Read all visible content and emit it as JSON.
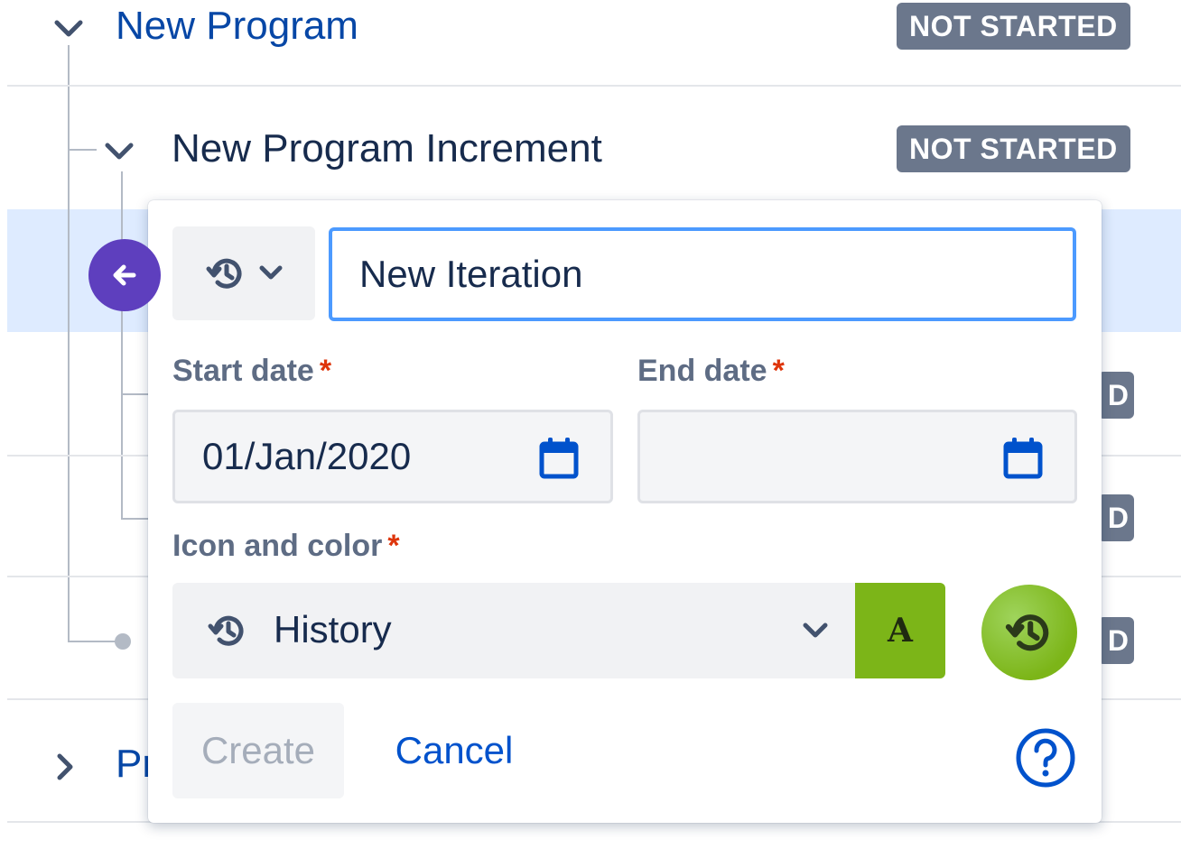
{
  "tree": {
    "rows": [
      {
        "title": "New Program",
        "status": "NOT STARTED"
      },
      {
        "title": "New Program Increment",
        "status": "NOT STARTED"
      },
      {
        "partial_badge": "D"
      },
      {
        "partial_badge": "D"
      },
      {
        "partial_badge": "D"
      },
      {
        "title_partial": "Pr"
      }
    ]
  },
  "popup": {
    "type_icon": "history-icon",
    "name_value": "New Iteration",
    "start_date": {
      "label": "Start date",
      "required": "*",
      "value": "01/Jan/2020"
    },
    "end_date": {
      "label": "End date",
      "required": "*",
      "value": ""
    },
    "icon_color": {
      "label": "Icon and color",
      "required": "*",
      "selected_icon": "History",
      "color_letter": "A",
      "color": "#7cb518"
    },
    "create_label": "Create",
    "cancel_label": "Cancel"
  },
  "colors": {
    "accent": "#0052cc",
    "badge": "#6b778c",
    "highlight": "#deebff",
    "back_button": "#5e3fbe",
    "focus_border": "#4c9aff",
    "required": "#de350b"
  }
}
